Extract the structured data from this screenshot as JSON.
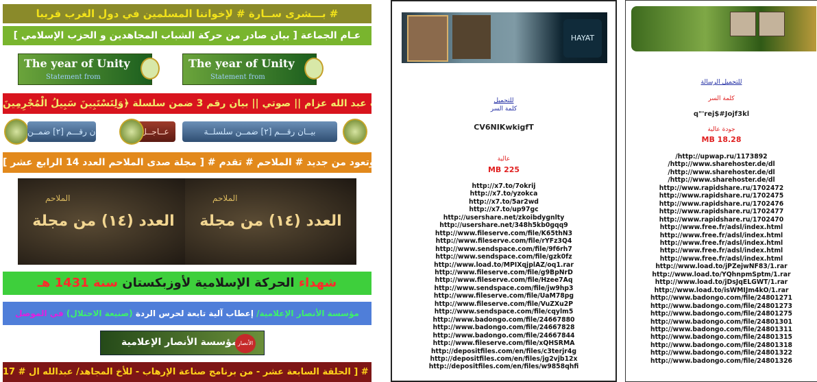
{
  "panel1": {
    "banner1": "بـــشرى ســارة # لإخواننا المسلمين في دول الغرب قريبا #",
    "banner2": "عـام الجماعة [ بيان صادر من حركة الشباب المجاهدين و الحزب الإسلامي ]",
    "unity_title": "The year of Unity",
    "unity_sub": "Statement from",
    "banner3": "كتائب عبد الله عزام || صوتي || بيان رقم 3 ضمن سلسلة ﴿وَلِتَسْتَبِينَ سَبِيلُ الْمُجْرِمِينَ﴾",
    "pill_left": "بيــان رقـــم [٢] ضمــن",
    "pill_mid": "عــاجــل",
    "pill_right": "بيــان رقـــم [٢] ضمــن سلسلــة",
    "banner4": "وتعود من جديد # الملاحم # تقدم # [ مجلة صدى الملاحم العدد 14 الرابع عشر ]",
    "mag_text": "العدد (١٤) من مجلة",
    "mag_label": "الملاحم",
    "banner5_a": "شهداء",
    "banner5_b": "الحركة الإسلامية لأوزبكستان",
    "banner5_c": "سنة 1431 هـ",
    "banner6_a": "مؤسسة الأنصار الإعلامية/",
    "banner6_b": "إعطاب آلية تابعة لحرس الردة",
    "banner6_c": "(صنيعة الاحتلال)",
    "banner6_d": "في الموصل",
    "ansar_text": "مؤسسة الأنصار الإعلامية",
    "ansar_logo": "الأنصار",
    "banner7": "17 # الفجر # يقدم # [ الحلقة السابعة عشر - من برنامج صناعة الإرهاب - للأخ المجاهد/ عبدالله ال"
  },
  "panel2": {
    "seal_text": "HAYAT",
    "download": "للتحميل",
    "password_label": "كلمة السر",
    "password": "CV6NIKwkigfT",
    "quality": "عالية",
    "size": "MB 225",
    "links": [
      "http://x7.to/7okrij",
      "http://x7.to/yzokca",
      "http://x7.to/5ar2wd",
      "http://x7.to/up97gc",
      "http://usershare.net/zkoibdygnlty",
      "http://usershare.net/348h5kb0gqq9",
      "http://www.fileserve.com/file/K65thN3",
      "http://www.fileserve.com/file/rYFz3Q4",
      "http://www.sendspace.com/file/9f6rh7",
      "http://www.sendspace.com/file/gzk0fz",
      "http://www.load.to/MPIXqjplAZ/oq1.rar",
      "http://www.fileserve.com/file/g9BpNrD",
      "http://www.fileserve.com/file/Hzee7Aq",
      "http://www.sendspace.com/file/jw9hp3",
      "http://www.fileserve.com/file/UaM78pg",
      "http://www.fileserve.com/file/VuZXu2P",
      "http://www.sendspace.com/file/cqylm5",
      "http://www.badongo.com/file/24667880",
      "http://www.badongo.com/file/24667828",
      "http://www.badongo.com/file/24667844",
      "http://www.fileserve.com/file/xQHSRMA",
      "http://depositfiles.com/en/files/c3terjr4g",
      "http://depositfiles.com/en/files/jg2vjb12x",
      "http://depositfiles.com/en/files/w9858qhfi"
    ]
  },
  "panel3": {
    "download": "للتحميل الرسالة",
    "password_label": "كلمة السر",
    "password": "q\"'rej$#Jojf3kl",
    "quality": "جودة عالية",
    "size": "MB 18.28",
    "links": [
      "/http://upwap.ru/1173892",
      "/http://www.sharehoster.de/dl",
      "/http://www.sharehoster.de/dl",
      "/http://www.sharehoster.de/dl",
      "http://www.rapidshare.ru/1702472",
      "http://www.rapidshare.ru/1702475",
      "http://www.rapidshare.ru/1702476",
      "http://www.rapidshare.ru/1702477",
      "http://www.rapidshare.ru/1702470",
      "http://www.free.fr/adsl/index.html",
      "http://www.free.fr/adsl/index.html",
      "http://www.free.fr/adsl/index.html",
      "http://www.free.fr/adsl/index.html",
      "http://www.free.fr/adsl/index.html",
      "http://www.load.to/jPZejwNF83/1.rar",
      "http://www.load.to/YQhnpmSptm/1.rar",
      "http://www.load.to/jDsJqELGWT/1.rar",
      "http://www.load.to/isWMIJm4kO/1.rar",
      "http://www.badongo.com/file/24801271",
      "http://www.badongo.com/file/24801273",
      "http://www.badongo.com/file/24801275",
      "http://www.badongo.com/file/24801301",
      "http://www.badongo.com/file/24801311",
      "http://www.badongo.com/file/24801315",
      "http://www.badongo.com/file/24801318",
      "http://www.badongo.com/file/24801322",
      "http://www.badongo.com/file/24801326"
    ]
  }
}
